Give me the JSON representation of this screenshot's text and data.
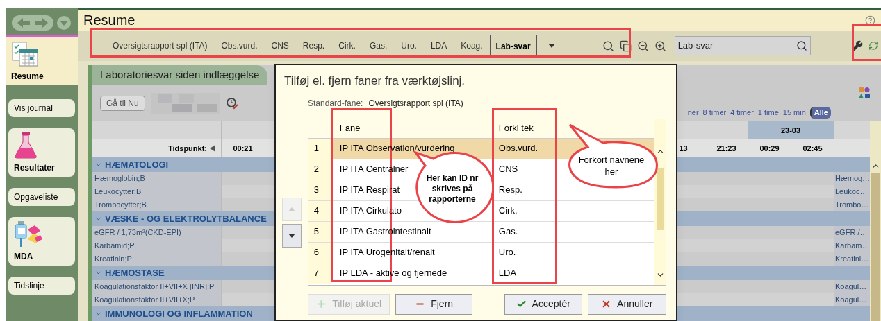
{
  "window": {
    "title": "Resume"
  },
  "sidebar": {
    "items": [
      {
        "label": "Resume",
        "kind": "big",
        "selected": true
      },
      {
        "label": "Vis journal",
        "kind": "small",
        "selected": false
      },
      {
        "label": "Resultater",
        "kind": "big",
        "selected": false
      },
      {
        "label": "Opgaveliste",
        "kind": "small",
        "selected": false
      },
      {
        "label": "MDA",
        "kind": "big",
        "selected": false
      },
      {
        "label": "Tidslinje",
        "kind": "small",
        "selected": false
      }
    ]
  },
  "toolbar": {
    "tabs": [
      {
        "label": "Oversigtsrapport spl (ITA)",
        "selected": false
      },
      {
        "label": "Obs.vurd.",
        "selected": false
      },
      {
        "label": "CNS",
        "selected": false
      },
      {
        "label": "Resp.",
        "selected": false
      },
      {
        "label": "Cirk.",
        "selected": false
      },
      {
        "label": "Gas.",
        "selected": false
      },
      {
        "label": "Uro.",
        "selected": false
      },
      {
        "label": "LDA",
        "selected": false
      },
      {
        "label": "Koag.",
        "selected": false
      },
      {
        "label": "Lab-svar",
        "selected": true
      }
    ],
    "search": {
      "value": "Lab-svar"
    }
  },
  "panel": {
    "title": "Laboratoriesvar siden indlæggelse",
    "goto_button": "Gå til Nu",
    "time_filters": [
      {
        "label": "ner",
        "selected": false
      },
      {
        "label": "8 timer",
        "selected": false
      },
      {
        "label": "4 timer",
        "selected": false
      },
      {
        "label": "1 time",
        "selected": false
      },
      {
        "label": "15 min",
        "selected": false
      },
      {
        "label": "Alle",
        "selected": true
      }
    ],
    "timepoint_label": "Tidspunkt:",
    "first_time": "00:21",
    "date_header": "23-03",
    "times": [
      "13",
      "21:23",
      "00:29",
      "02:45"
    ],
    "sections": [
      {
        "title": "HÆMATOLOGI",
        "rows": [
          {
            "name": "Hæmoglobin;B",
            "short": "Hæmog…"
          },
          {
            "name": "Leukocytter;B",
            "short": "Leukoc…"
          },
          {
            "name": "Trombocytter;B",
            "short": "Trombo…"
          }
        ]
      },
      {
        "title": "VÆSKE - OG ELEKTROLYTBALANCE",
        "rows": [
          {
            "name": "eGFR / 1,73m²(CKD-EPI)",
            "short": "eGFR /…"
          },
          {
            "name": "Karbamid;P",
            "short": "Karbam…"
          },
          {
            "name": "Kreatinin;P",
            "short": "Kreatini…"
          }
        ]
      },
      {
        "title": "HÆMOSTASE",
        "rows": [
          {
            "name": "Koagulationsfaktor II+VII+X [INR];P",
            "short": "Koagul…"
          },
          {
            "name": "Koagulationsfaktor II+VII+X;P",
            "short": "Koagul…"
          }
        ]
      },
      {
        "title": "IMMUNOLOGI OG INFLAMMATION"
      }
    ]
  },
  "dialog": {
    "title": "Tilføj el. fjern faner fra værktøjslinj.",
    "standard_label": "Standard-fane:",
    "standard_value": "Oversigtsrapport spl (ITA)",
    "columns": [
      "Fane",
      "Forkl tek"
    ],
    "rows": [
      {
        "number": "1",
        "name": "IP ITA Observation/vurdering",
        "short": "Obs.vurd.",
        "selected": true
      },
      {
        "number": "2",
        "name": "IP ITA Centralner",
        "short": "CNS",
        "selected": false
      },
      {
        "number": "3",
        "name": "IP ITA Respirat",
        "short": "Resp.",
        "selected": false
      },
      {
        "number": "4",
        "name": "IP ITA Cirkulato",
        "short": "Cirk.",
        "selected": false
      },
      {
        "number": "5",
        "name": "IP ITA Gastrointestinalt",
        "short": "Gas.",
        "selected": false
      },
      {
        "number": "6",
        "name": "IP ITA Urogenitalt/renalt",
        "short": "Uro.",
        "selected": false
      },
      {
        "number": "7",
        "name": "IP LDA - aktive og fjernede",
        "short": "LDA",
        "selected": false
      }
    ],
    "move_up": {
      "disabled": true
    },
    "move_down": {
      "disabled": false
    },
    "buttons": [
      {
        "label": "Tilføj aktuel",
        "kind": "add",
        "disabled": true
      },
      {
        "label": "Fjern",
        "kind": "remove",
        "disabled": false
      },
      {
        "label": "Acceptér",
        "kind": "accept",
        "disabled": false
      },
      {
        "label": "Annuller",
        "kind": "cancel",
        "disabled": false
      }
    ]
  },
  "callouts": [
    {
      "text": "Her kan ID nr skrives på rapporterne"
    },
    {
      "text": "Forkort navnene her"
    }
  ]
}
